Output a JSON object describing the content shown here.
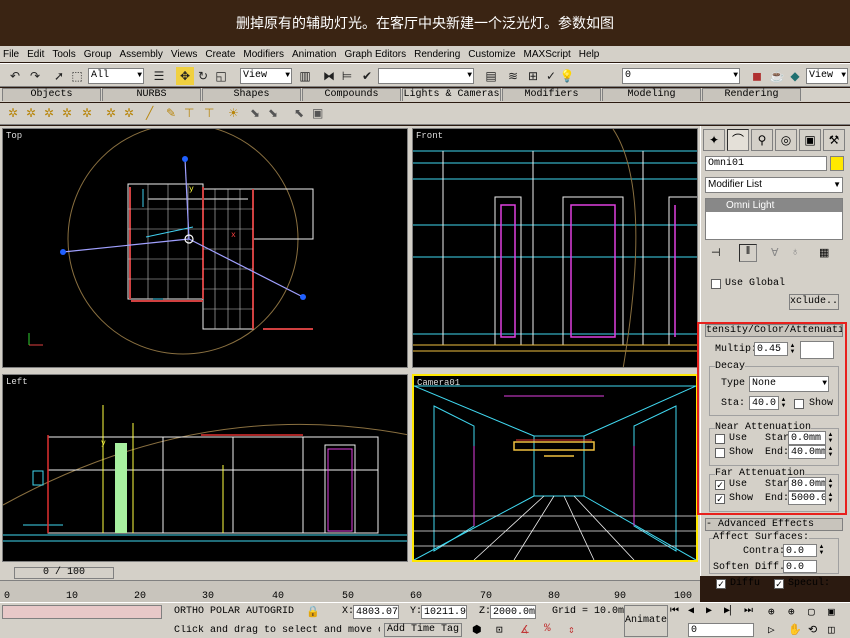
{
  "caption": "删掉原有的辅助灯光。在客厅中央新建一个泛光灯。参数如图",
  "menu": [
    "File",
    "Edit",
    "Tools",
    "Group",
    "Assembly",
    "Views",
    "Create",
    "Modifiers",
    "Animation",
    "Graph Editors",
    "Rendering",
    "Customize",
    "MAXScript",
    "Help"
  ],
  "toolbar": {
    "selection_filter": "All",
    "ref_coord": "View",
    "named_sel": "",
    "layer": "0",
    "view_right": "View"
  },
  "tabs": [
    "Objects",
    "NURBS",
    "Shapes",
    "Compounds",
    "Lights & Cameras",
    "Modifiers",
    "Modeling",
    "Rendering"
  ],
  "viewports": {
    "top": "Top",
    "front": "Front",
    "left": "Left",
    "camera": "Camera01"
  },
  "panel": {
    "object_name": "Omni01",
    "modifier_list": "Modifier List",
    "stack_item": "Omni Light",
    "use_global": "Use Global",
    "exclude": "xclude..",
    "intensity_rollout": "tensity/Color/Attenuati",
    "multiplier_label": "Multip:",
    "multiplier": "0.45",
    "decay_group": "Decay",
    "decay_type_label": "Type",
    "decay_type": "None",
    "decay_start_label": "Sta:",
    "decay_start": "40.0:",
    "show_label": "Show",
    "near_group": "Near Attenuation",
    "use_label": "Use",
    "start_label": "Star",
    "end_label": "End:",
    "near_start": "0.0mm",
    "near_end": "40.0mm",
    "far_group": "Far Attenuation",
    "far_start": "80.0mm",
    "far_end": "5000.0",
    "advanced_rollout": "- Advanced Effects",
    "affect_surfaces": "Affect Surfaces:",
    "contrast_label": "Contra:",
    "contrast": "0.0",
    "soften_label": "Soften Diff.",
    "soften": "0.0",
    "diffuse_label": "Diffu",
    "specular_label": "Specul:"
  },
  "timeline": {
    "slider": "0 / 100",
    "ticks": [
      "0",
      "10",
      "20",
      "30",
      "40",
      "50",
      "60",
      "70",
      "80",
      "90",
      "100"
    ]
  },
  "status": {
    "modes": "ORTHO  POLAR  AUTOGRID",
    "x_label": "X:",
    "x_val": "4803.07",
    "y_label": "Y:",
    "y_val": "10211.9",
    "z_label": "Z:",
    "z_val": "2000.0m",
    "grid": "Grid = 10.0m",
    "prompt": "Click and drag to select and move o",
    "add_time_tag": "Add Time Tag",
    "animate": "Animate",
    "frame": "0"
  }
}
